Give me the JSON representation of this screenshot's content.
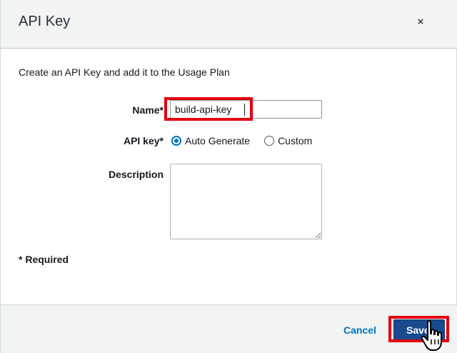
{
  "dialog": {
    "title": "API Key",
    "close_symbol": "×",
    "intro": "Create an API Key and add it to the Usage Plan"
  },
  "form": {
    "name_label": "Name*",
    "name_value": "build-api-key",
    "apikey_label": "API key*",
    "apikey_options": [
      {
        "label": "Auto Generate",
        "selected": true
      },
      {
        "label": "Custom",
        "selected": false
      }
    ],
    "description_label": "Description",
    "description_value": "",
    "required_note": "* Required"
  },
  "footer": {
    "cancel_label": "Cancel",
    "save_label": "Save"
  },
  "annotations": {
    "highlight_color": "#e3000f"
  },
  "colors": {
    "accent": "#0073bb",
    "primary_button": "#1a4a8d"
  },
  "icons": {
    "close": "close-icon",
    "pointer": "hand-pointer-icon"
  }
}
